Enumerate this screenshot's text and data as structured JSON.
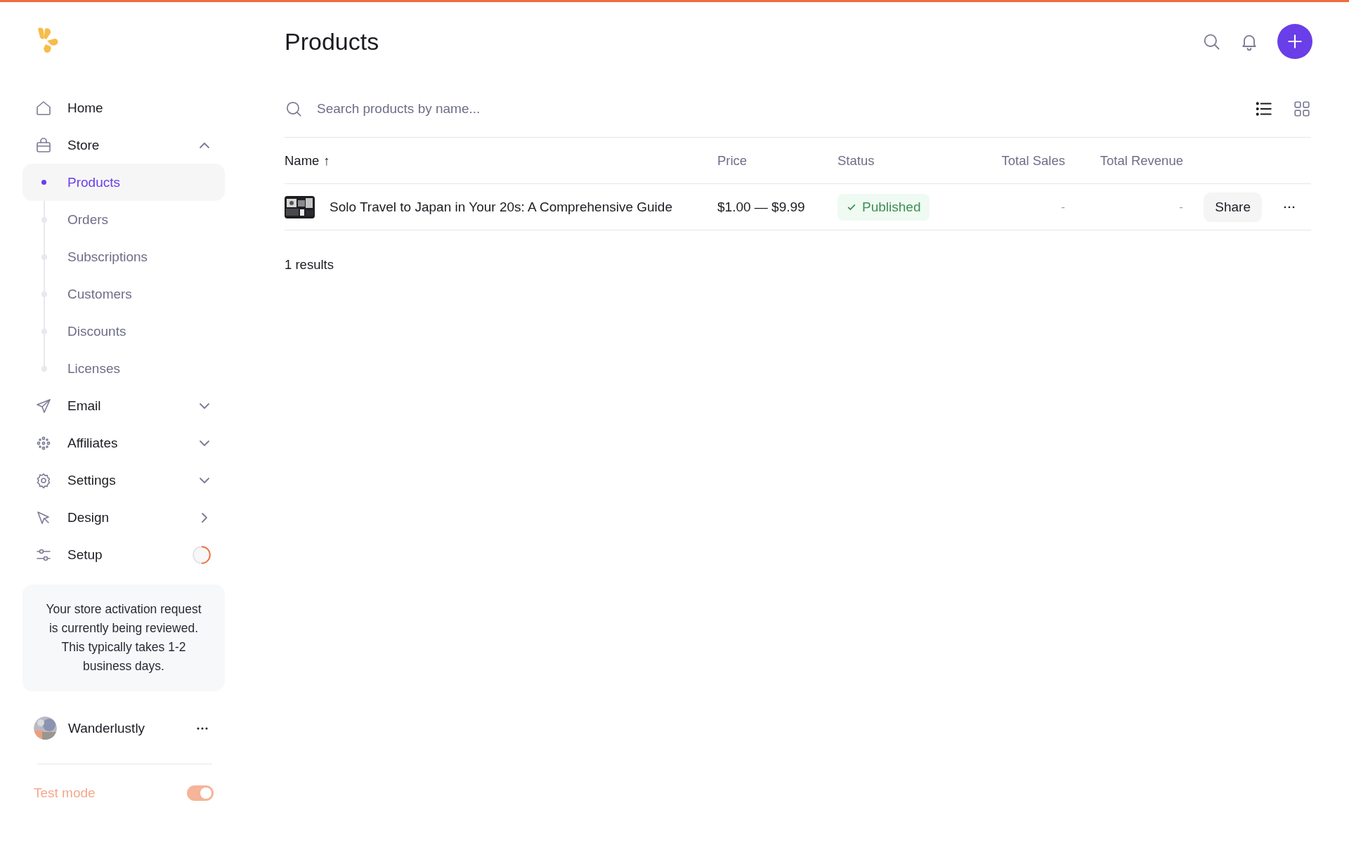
{
  "page_title": "Products",
  "nav": [
    {
      "label": "Home",
      "kind": "link"
    },
    {
      "label": "Store",
      "kind": "group",
      "expanded": true,
      "children": [
        {
          "label": "Products",
          "selected": true
        },
        {
          "label": "Orders",
          "selected": false
        },
        {
          "label": "Subscriptions",
          "selected": false
        },
        {
          "label": "Customers",
          "selected": false
        },
        {
          "label": "Discounts",
          "selected": false
        },
        {
          "label": "Licenses",
          "selected": false
        }
      ]
    },
    {
      "label": "Email",
      "kind": "group",
      "expanded": false
    },
    {
      "label": "Affiliates",
      "kind": "group",
      "expanded": false
    },
    {
      "label": "Settings",
      "kind": "group",
      "expanded": false
    },
    {
      "label": "Design",
      "kind": "submenu"
    },
    {
      "label": "Setup",
      "kind": "progress",
      "level": 0.5
    }
  ],
  "notice": "Your store activation request is currently being reviewed. This typically takes 1-2 business days.",
  "account": {
    "name": "Wanderlustly"
  },
  "test_mode": {
    "label": "Test mode",
    "on": true
  },
  "search": {
    "placeholder": "Search products by name..."
  },
  "view_options": [
    {
      "kind": "list",
      "selected": true
    },
    {
      "kind": "grid",
      "selected": false
    }
  ],
  "table": {
    "columns": [
      {
        "label": "Name",
        "sort": "↑"
      },
      {
        "label": "Price"
      },
      {
        "label": "Status"
      },
      {
        "label": "Total Sales"
      },
      {
        "label": "Total Revenue"
      }
    ],
    "rows": [
      {
        "name": "Solo Travel to Japan in Your 20s: A Comprehensive Guide",
        "price": "$1.00 — $9.99",
        "status": {
          "label": "Published",
          "kind": "published"
        },
        "total_sales": "-",
        "total_revenue": "-",
        "action": "Share"
      }
    ]
  },
  "results_count": "1 results"
}
